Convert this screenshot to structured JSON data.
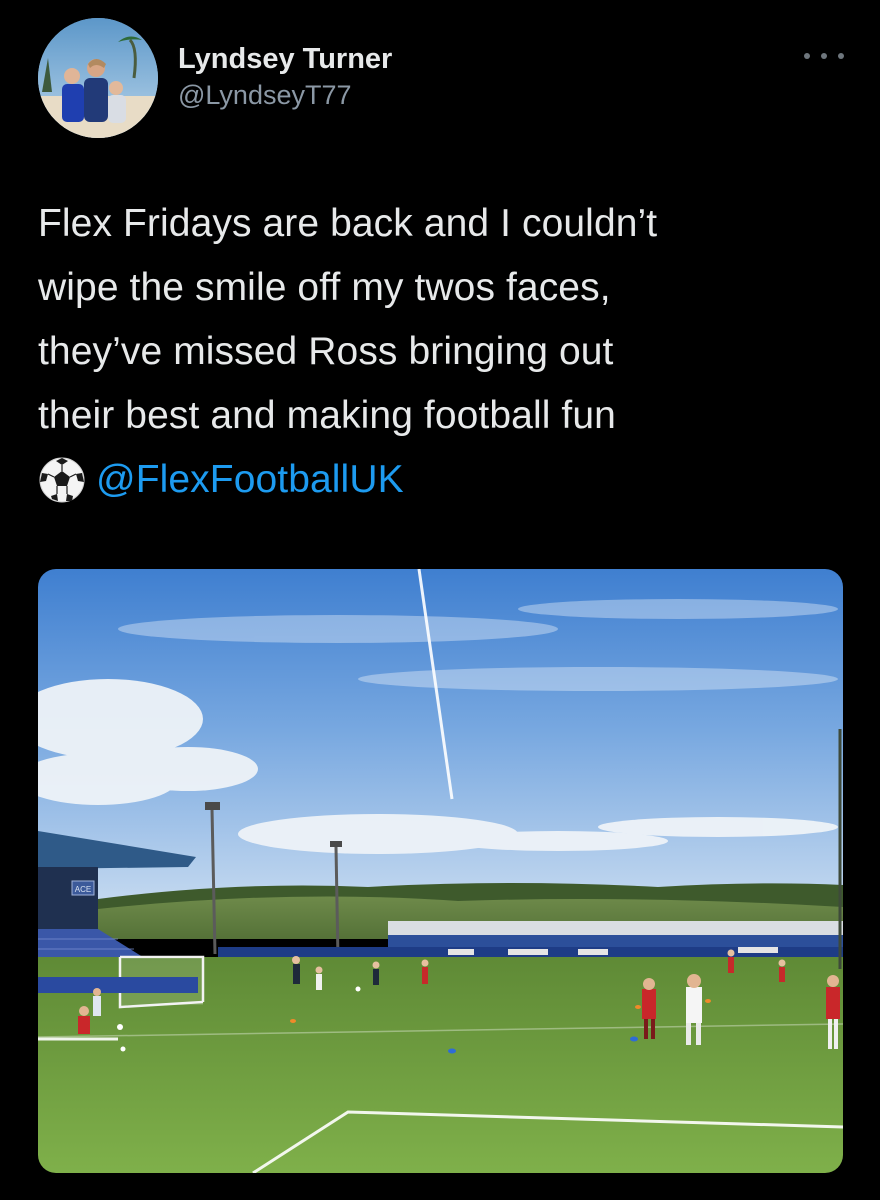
{
  "tweet": {
    "author": {
      "display_name": "Lyndsey Turner",
      "handle": "@LyndseyT77"
    },
    "text_lines": [
      "Flex Fridays are back and I couldn’t",
      "wipe the smile off my twos faces,",
      "they’ve missed Ross bringing out",
      "their best and making football fun"
    ],
    "emoji": "⚽",
    "mention": "@FlexFootballUK",
    "more_icon": "more-horizontal-icon",
    "media": {
      "type": "photo",
      "subject": "youth football training on an artificial pitch in a stadium",
      "stand_sign": "ACE"
    }
  },
  "colors": {
    "background": "#000000",
    "text": "#e7e9ea",
    "secondary_text": "#8b98a5",
    "link": "#1d9bf0",
    "icon_muted": "#6e767d"
  }
}
